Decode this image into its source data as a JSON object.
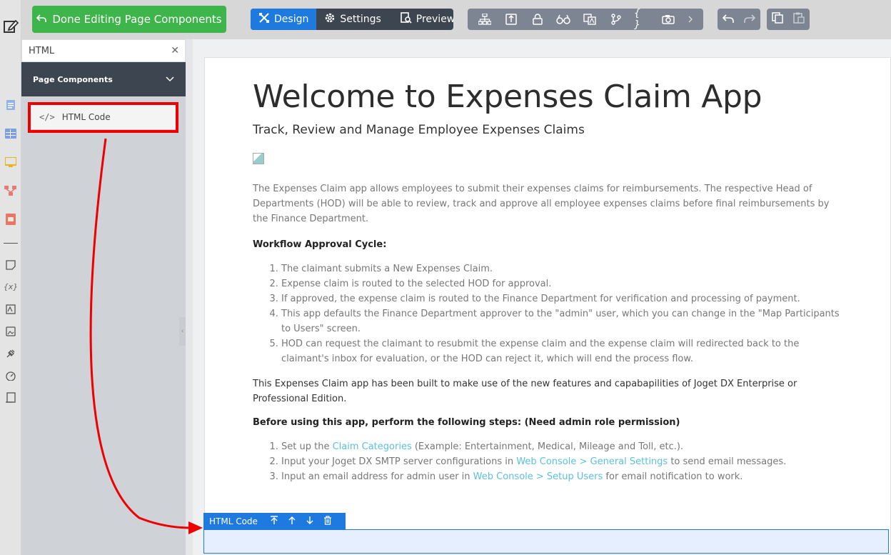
{
  "toolbar": {
    "done_label": "Done Editing Page Components",
    "modes": [
      {
        "label": "Design",
        "active": true
      },
      {
        "label": "Settings",
        "active": false
      },
      {
        "label": "Preview",
        "active": false
      }
    ]
  },
  "sidebar": {
    "search_value": "HTML",
    "section_title": "Page Components",
    "component_label": "HTML Code"
  },
  "content": {
    "title": "Welcome to Expenses Claim App",
    "subtitle": "Track, Review and Manage Employee Expenses Claims",
    "intro": "The Expenses Claim app allows employees to submit their expenses claims for reimbursements. The respective Head of Departments (HOD) will be able to review, track and approve all employee expenses claims before final reimbursements by the Finance Department.",
    "workflow_heading": "Workflow Approval Cycle:",
    "workflow_steps": [
      "The claimant submits a New Expenses Claim.",
      "Expense claim is routed to the selected HOD for approval.",
      "If approved, the expense claim is routed to the Finance Department for verification and processing of payment.",
      "This app defaults the Finance Department approver to the \"admin\" user, which you can change in the \"Map Participants to Users\" screen.",
      "HOD can request the claimant to resubmit the expense claim and the expense claim will redirected back to the claimant's inbox for evaluation, or the HOD can reject it, which will end the process flow."
    ],
    "built_with": "This Expenses Claim app has been built to make use of the new features and capabapilities of Joget DX Enterprise or Professional Edition.",
    "before_heading": "Before using this app, perform the following steps: (Need admin role permission)",
    "setup": {
      "s1_pre": "Set up the ",
      "s1_link": "Claim Categories",
      "s1_post": " (Example: Entertainment, Medical, Mileage and Toll, etc.).",
      "s2_pre": "Input your Joget DX SMTP server configurations in ",
      "s2_link": "Web Console > General Settings",
      "s2_post": " to send email messages.",
      "s3_pre": "Input an email address for admin user in ",
      "s3_link": "Web Console > Setup Users",
      "s3_post": " for email notification to work."
    }
  },
  "component_tag": {
    "label": "HTML Code"
  },
  "colors": {
    "done_button": "#3db54a",
    "active_mode": "#1f7ae0",
    "highlight": "#ef0000",
    "link": "#5bc0de"
  }
}
